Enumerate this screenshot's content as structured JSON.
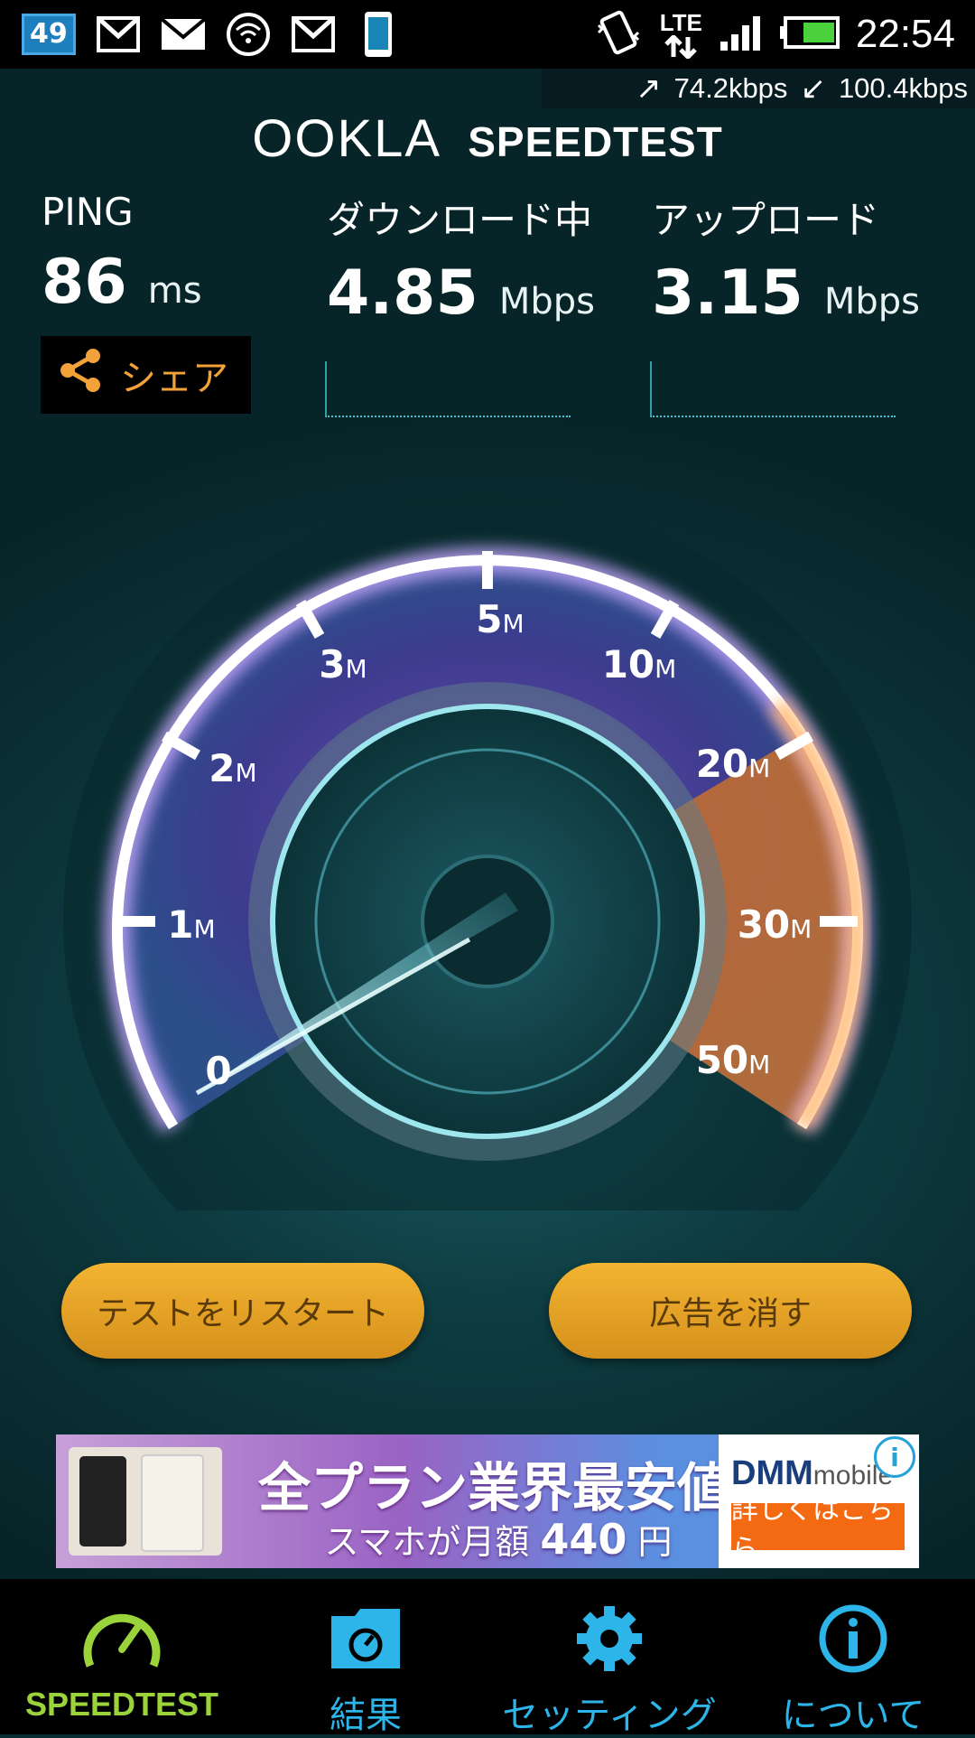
{
  "status_bar": {
    "notification_count": "49",
    "icons": [
      "gmail-icon",
      "mail-icon",
      "wifi-hotspot-icon",
      "gmail-icon",
      "phone-icon"
    ],
    "right_icons": [
      "vibrate-icon",
      "lte-icon",
      "signal-icon",
      "battery-icon"
    ],
    "lte_label": "LTE",
    "clock": "22:54"
  },
  "rates": {
    "up": "74.2kbps",
    "down": "100.4kbps"
  },
  "header": {
    "logo": "OOKLA",
    "title": "SPEEDTEST"
  },
  "metrics": {
    "ping": {
      "label": "PING",
      "value": "86",
      "unit": "ms"
    },
    "download": {
      "label": "ダウンロード中",
      "value": "4.85",
      "unit": "Mbps"
    },
    "upload": {
      "label": "アップロード",
      "value": "3.15",
      "unit": "Mbps"
    }
  },
  "share_label": "シェア",
  "gauge": {
    "labels": [
      {
        "num": "0",
        "unit": ""
      },
      {
        "num": "1",
        "unit": "M"
      },
      {
        "num": "2",
        "unit": "M"
      },
      {
        "num": "3",
        "unit": "M"
      },
      {
        "num": "5",
        "unit": "M"
      },
      {
        "num": "10",
        "unit": "M"
      },
      {
        "num": "20",
        "unit": "M"
      },
      {
        "num": "30",
        "unit": "M"
      },
      {
        "num": "50",
        "unit": "M"
      }
    ],
    "accent": "#f28a2e",
    "needle_value_mbps": 0.4
  },
  "buttons": {
    "restart": "テストをリスタート",
    "remove_ads": "広告を消す"
  },
  "ad": {
    "headline": "全プラン業界最安値",
    "sub_prefix": "スマホが月額",
    "sub_price": "440",
    "sub_suffix": "円",
    "brand": "DMM",
    "brand_suffix": "mobile",
    "cta": "詳しくはこちら",
    "info": "i"
  },
  "nav": {
    "tabs": [
      {
        "label": "SPEEDTEST",
        "icon": "speedometer-icon",
        "active": true
      },
      {
        "label": "結果",
        "icon": "results-folder-icon"
      },
      {
        "label": "セッティング",
        "icon": "gear-icon"
      },
      {
        "label": "について",
        "icon": "info-icon"
      }
    ],
    "active_color": "#9ad43a",
    "color": "#2db4e8"
  }
}
